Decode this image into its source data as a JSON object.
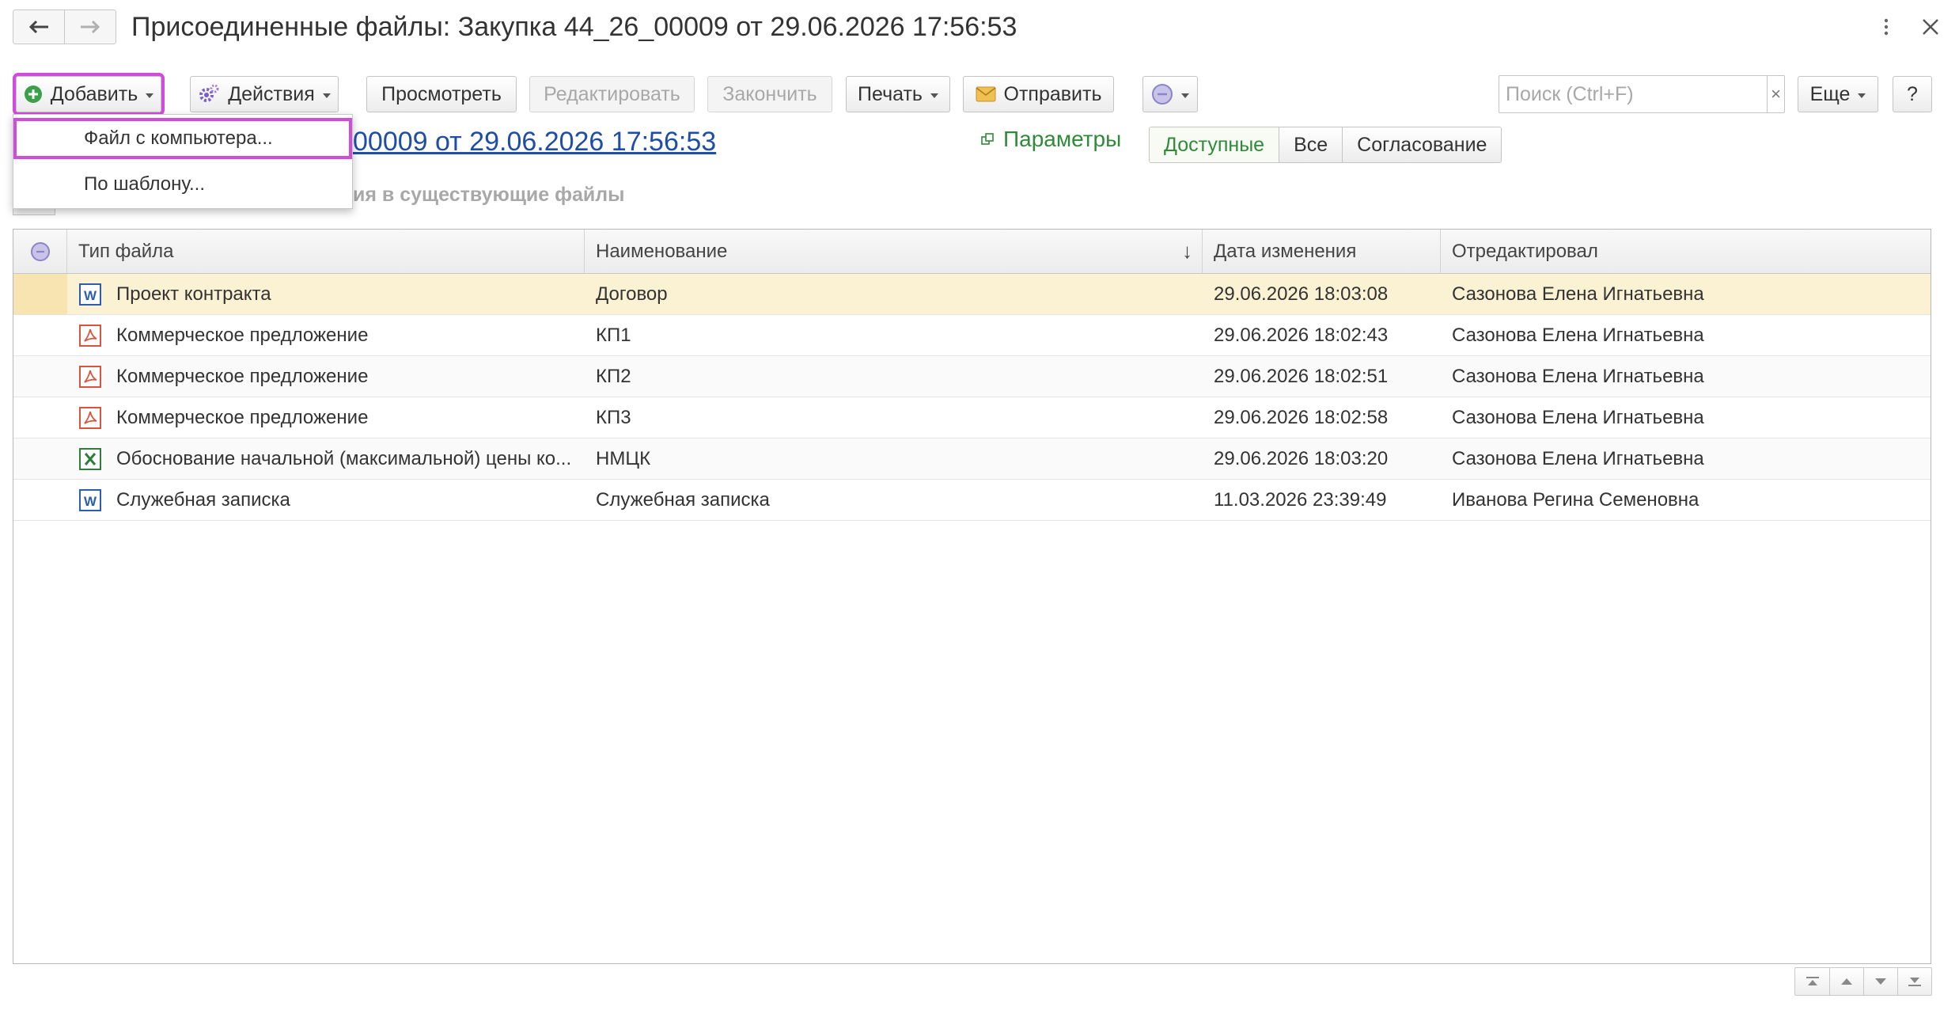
{
  "window": {
    "title": "Присоединенные файлы: Закупка 44_26_00009 от 29.06.2026 17:56:53"
  },
  "toolbar": {
    "add_label": "Добавить",
    "actions_label": "Действия",
    "view_label": "Просмотреть",
    "edit_label": "Редактировать",
    "finish_label": "Закончить",
    "print_label": "Печать",
    "send_label": "Отправить",
    "search_placeholder": "Поиск (Ctrl+F)",
    "search_clear": "×",
    "more_label": "Еще",
    "help_label": "?"
  },
  "add_menu": {
    "items": [
      {
        "label": "Файл с компьютера..."
      },
      {
        "label": "По шаблону..."
      }
    ]
  },
  "owner_link": "00009 от 29.06.2026 17:56:53",
  "params_label": "Параметры",
  "filters": [
    {
      "label": "Доступные",
      "active": true
    },
    {
      "label": "Все",
      "active": false
    },
    {
      "label": "Согласование",
      "active": false
    }
  ],
  "partial_text": "ия в существующие файлы",
  "table": {
    "columns": [
      "Тип файла",
      "Наименование",
      "Дата изменения",
      "Отредактировал"
    ],
    "sort_indicator": "↓",
    "rows": [
      {
        "icon": "word-icon",
        "type": "Проект контракта",
        "name": "Договор",
        "date": "29.06.2026 18:03:08",
        "user": "Сазонова Елена Игнатьевна"
      },
      {
        "icon": "pdf-icon",
        "type": "Коммерческое предложение",
        "name": "КП1",
        "date": "29.06.2026 18:02:43",
        "user": "Сазонова Елена Игнатьевна"
      },
      {
        "icon": "pdf-icon",
        "type": "Коммерческое предложение",
        "name": "КП2",
        "date": "29.06.2026 18:02:51",
        "user": "Сазонова Елена Игнатьевна"
      },
      {
        "icon": "pdf-icon",
        "type": "Коммерческое предложение",
        "name": "КП3",
        "date": "29.06.2026 18:02:58",
        "user": "Сазонова Елена Игнатьевна"
      },
      {
        "icon": "excel-icon",
        "type": "Обоснование начальной (максимальной) цены ко...",
        "name": "НМЦК",
        "date": "29.06.2026 18:03:20",
        "user": "Сазонова Елена Игнатьевна"
      },
      {
        "icon": "word-icon",
        "type": "Служебная записка",
        "name": "Служебная записка",
        "date": "11.03.2026 23:39:49",
        "user": "Иванова Регина Семеновна"
      }
    ]
  },
  "colors": {
    "highlight": "#d14bdc",
    "selected_row": "#fbf1d3",
    "link": "#1f4ea8",
    "green": "#2f8a3a",
    "word": "#2b5eb0",
    "pdf": "#d9543f",
    "excel": "#2e7d3a"
  }
}
